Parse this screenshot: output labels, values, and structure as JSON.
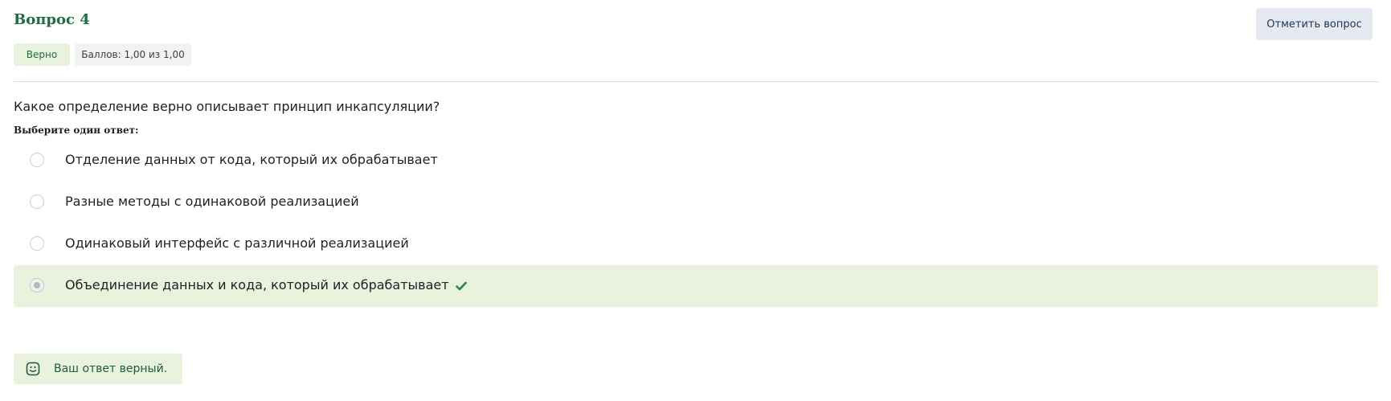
{
  "question": {
    "title": "Вопрос 4",
    "status": "Верно",
    "score": "Баллов: 1,00 из 1,00",
    "flag_label": "Отметить вопрос",
    "text": "Какое определение верно описывает принцип инкапсуляции?",
    "prompt": "Выберите один ответ:",
    "answers": [
      {
        "label": "Отделение данных от кода, который их обрабатывает",
        "selected": false,
        "correct": false
      },
      {
        "label": "Разные методы с одинаковой реализацией",
        "selected": false,
        "correct": false
      },
      {
        "label": "Одинаковый интерфейс с различной реализацией",
        "selected": false,
        "correct": false
      },
      {
        "label": "Объединение данных и кода, который их обрабатывает",
        "selected": true,
        "correct": true
      }
    ],
    "feedback": "Ваш ответ верный.",
    "icons": {
      "correct_mark": "check-icon",
      "feedback": "smile-icon"
    }
  },
  "colors": {
    "title": "#1e6e3f",
    "correct_bg": "#e8f2dc",
    "score_bg": "#f2f2f2",
    "flag_bg": "#e4e9f2",
    "check": "#2e8540"
  }
}
